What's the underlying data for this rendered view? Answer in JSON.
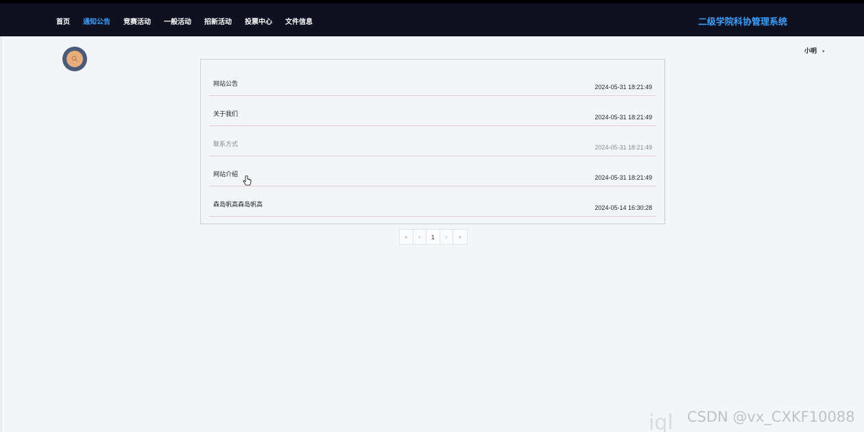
{
  "nav": {
    "items": [
      {
        "label": "首页",
        "active": false
      },
      {
        "label": "通知公告",
        "active": true
      },
      {
        "label": "竞赛活动",
        "active": false
      },
      {
        "label": "一般活动",
        "active": false
      },
      {
        "label": "招新活动",
        "active": false
      },
      {
        "label": "投票中心",
        "active": false
      },
      {
        "label": "文件信息",
        "active": false
      }
    ],
    "brand": "二级学院科协管理系统"
  },
  "user": {
    "name": "小明"
  },
  "notices": [
    {
      "title": "网站公告",
      "time": "2024-05-31 18:21:49"
    },
    {
      "title": "关于我们",
      "time": "2024-05-31 18:21:49"
    },
    {
      "title": "联系方式",
      "time": "2024-05-31 18:21:49"
    },
    {
      "title": "网站介绍",
      "time": "2024-05-31 18:21:49"
    },
    {
      "title": "森岛帆高森岛帆高",
      "time": "2024-05-14 16:30:28"
    }
  ],
  "pagination": {
    "first": "«",
    "prev": "‹",
    "current": "1",
    "next": "›",
    "last": "»"
  },
  "watermark": "CSDN @vx_CXKF10088",
  "colors": {
    "topbar": "#0f1020",
    "accent": "#3aa0ff",
    "search_outer": "#4b5a78",
    "search_inner": "#e7ad7c"
  }
}
